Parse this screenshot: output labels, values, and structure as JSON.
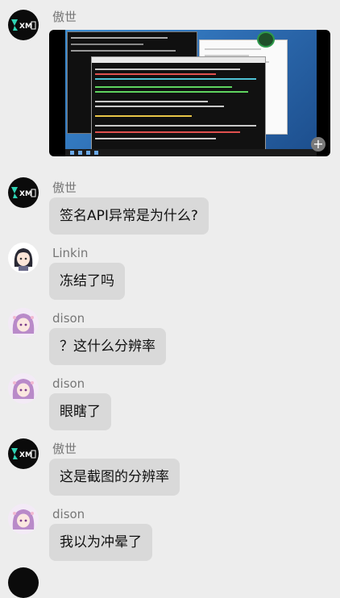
{
  "messages": [
    {
      "sender": "傲世",
      "avatar": "xm-logo-avatar",
      "type": "image"
    },
    {
      "sender": "傲世",
      "avatar": "xm-logo-avatar",
      "text": "签名API异常是为什么?"
    },
    {
      "sender": "Linkin",
      "avatar": "anime-girl-dark-hair-avatar",
      "text": "冻结了吗"
    },
    {
      "sender": "dison",
      "avatar": "anime-girl-purple-hair-avatar",
      "text": "？这什么分辨率"
    },
    {
      "sender": "dison",
      "avatar": "anime-girl-purple-hair-avatar",
      "text": "眼瞎了"
    },
    {
      "sender": "傲世",
      "avatar": "xm-logo-avatar",
      "text": "这是截图的分辨率"
    },
    {
      "sender": "dison",
      "avatar": "anime-girl-purple-hair-avatar",
      "text": "我以为冲晕了"
    }
  ],
  "colors": {
    "background": "#ededed",
    "bubble": "#d9d9d9",
    "name": "#777777",
    "brand_xm": "#2fd3b4"
  },
  "icons": {
    "expand": "plus-icon"
  }
}
